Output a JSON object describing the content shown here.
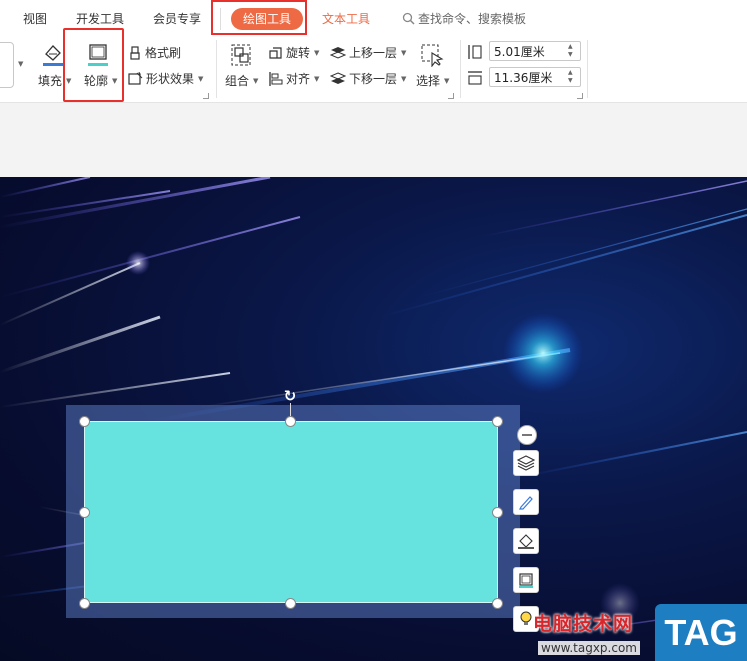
{
  "tabs": {
    "view": "视图",
    "dev": "开发工具",
    "vip": "会员专享",
    "draw": "绘图工具",
    "text": "文本工具",
    "search_label": "查找命令、搜索模板",
    "active_color": "#ee6a45"
  },
  "ribbon": {
    "fill": "填充",
    "outline": "轮廓",
    "format_painter": "格式刷",
    "shape_effects": "形状效果",
    "group": "组合",
    "rotate": "旋转",
    "align": "对齐",
    "bring_forward": "上移一层",
    "send_backward": "下移一层",
    "select": "选择",
    "height_value": "5.01厘米",
    "width_value": "11.36厘米"
  },
  "shape": {
    "fill_color": "#66e3df",
    "highlight_color": "#e8312c"
  },
  "watermark": {
    "site_name": "电脑技术网",
    "url": "www.tagxp.com",
    "tag": "TAG"
  },
  "icons": [
    "search-icon",
    "fill-icon",
    "outline-icon",
    "brush-icon",
    "shape-effect-icon",
    "group-icon",
    "rotate-icon",
    "align-icon",
    "layer-up-icon",
    "layer-down-icon",
    "select-cursor-icon",
    "height-icon",
    "width-icon",
    "rotate-handle-icon",
    "layers-icon",
    "pen-icon",
    "fill-bucket-icon",
    "outline-square-icon",
    "bulb-icon"
  ]
}
